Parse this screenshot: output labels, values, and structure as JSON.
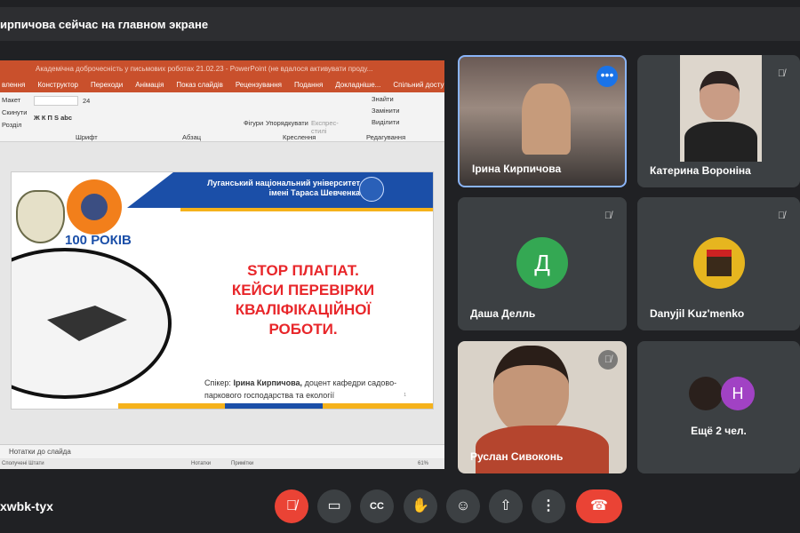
{
  "header": {
    "presenting_text": "ирпичова сейчас на главном экране"
  },
  "powerpoint": {
    "title": "Академічна доброчесність у письмових роботах 21.02.23 - PowerPoint (не вдалося активувати проду...",
    "tabs": [
      "влення",
      "Конструктор",
      "Переходи",
      "Анімація",
      "Показ слайдів",
      "Рецензування",
      "Подання",
      "Докладніше...",
      "Спільний доступ"
    ],
    "ribbon": {
      "layout": "Макет",
      "reset": "Скинути",
      "section": "Розділ",
      "font_size": "24",
      "font_group": "Шрифт",
      "paragraph_group": "Абзац",
      "shapes": "Фігури",
      "arrange": "Упорядкувати",
      "quick_styles": "Експрес-стилі",
      "drawing_group": "Креслення",
      "find": "Знайти",
      "replace": "Замінити",
      "select": "Виділити",
      "editing_group": "Редагування"
    },
    "slide": {
      "university": "Луганський національний університет",
      "university2": "імені Тараса Шевченка",
      "years": "100 РОКІВ",
      "headline": [
        "STOP ПЛАГІАТ.",
        "КЕЙСИ ПЕРЕВІРКИ",
        "КВАЛІФІКАЦІЙНОЇ",
        "РОБОТИ."
      ],
      "speaker_label": "Спікер:",
      "speaker_name": "Ірина Кирпичова,",
      "speaker_role": "доцент кафедри садово-паркового господарства та екології",
      "page": "1"
    },
    "notes": "Нотатки до слайда",
    "status": {
      "left": "Сполучені Штати",
      "notes": "Нотатки",
      "comments": "Примітки",
      "zoom": "61%"
    }
  },
  "participants": [
    {
      "name": "Ірина Кирпичова",
      "active": true
    },
    {
      "name": "Катерина Вороніна"
    },
    {
      "name": "Даша Делль",
      "initial": "Д",
      "color": "#34a853"
    },
    {
      "name": "Danyjil Kuz'menko"
    },
    {
      "name": "Руслан Сивоконь"
    }
  ],
  "more": {
    "label": "Ещё 2 чел.",
    "initial": "Н",
    "color": "#a142c4"
  },
  "meeting_code": "xwbk-tyx",
  "colors": {
    "danger": "#ea4335",
    "accent": "#8ab4f8"
  }
}
